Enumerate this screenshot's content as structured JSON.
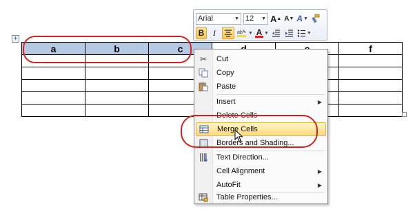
{
  "table": {
    "headers": [
      "a",
      "b",
      "c",
      "d",
      "e",
      "f"
    ],
    "selected_columns": 3,
    "body_rows": 5
  },
  "mini_toolbar": {
    "font_name": "Arial",
    "font_size": "12",
    "grow_font": "A",
    "shrink_font": "A",
    "styles_label": "A",
    "bold": "B",
    "italic": "I",
    "font_color": "A"
  },
  "context_menu": {
    "items": [
      {
        "label": "Cut",
        "icon": "scissors-icon"
      },
      {
        "label": "Copy",
        "icon": "copy-icon"
      },
      {
        "label": "Paste",
        "icon": "paste-icon"
      },
      {
        "label": "Insert",
        "icon": "",
        "submenu": true
      },
      {
        "label": "Delete Cells",
        "icon": ""
      },
      {
        "label": "Merge Cells",
        "icon": "merge-cells-icon",
        "highlighted": true
      },
      {
        "label": "Borders and Shading...",
        "icon": "borders-icon"
      },
      {
        "label": "Text Direction...",
        "icon": "text-direction-icon"
      },
      {
        "label": "Cell Alignment",
        "icon": "",
        "submenu": true
      },
      {
        "label": "AutoFit",
        "icon": "",
        "submenu": true
      },
      {
        "label": "Table Properties...",
        "icon": "table-properties-icon"
      }
    ]
  },
  "colors": {
    "selection": "#b6c9e3",
    "highlight_oval": "#d42020",
    "menu_hover": "#ffd97a"
  }
}
